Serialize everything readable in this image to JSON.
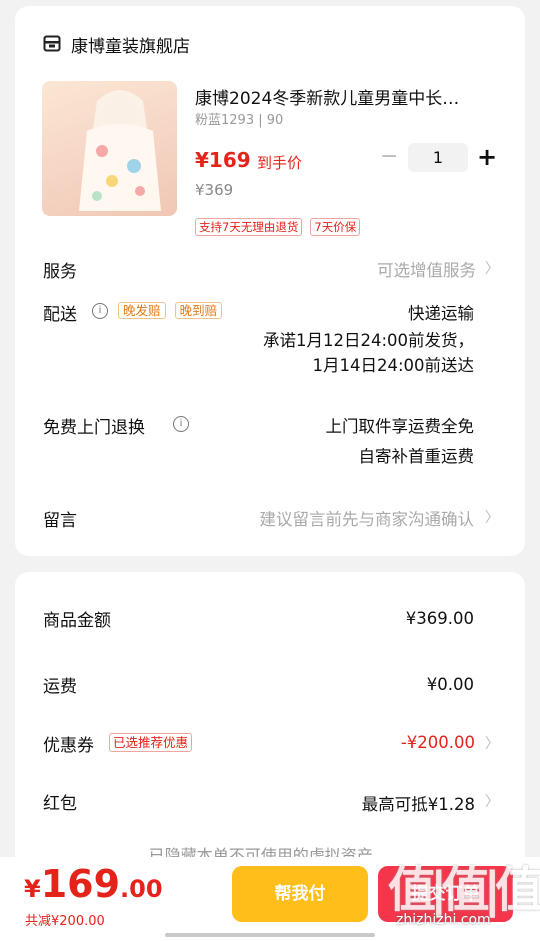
{
  "store": {
    "name": "康博童装旗舰店",
    "icon": "store-icon"
  },
  "product": {
    "title": "康博2024冬季新款儿童男童中长…",
    "variant": "粉蓝1293 | 90",
    "price": "¥169",
    "price_tag": "到手价",
    "original_price": "¥369",
    "badges": [
      "支持7天无理由退货",
      "7天价保"
    ],
    "quantity": "1"
  },
  "rows": {
    "service": {
      "label": "服务",
      "hint": "可选增值服务"
    },
    "delivery": {
      "label": "配送",
      "tags": [
        "晚发赔",
        "晚到赔"
      ],
      "method": "快递运输",
      "promise_line1": "承诺1月12日24:00前发货，",
      "promise_line2": "1月14日24:00前送达"
    },
    "return": {
      "label": "免费上门退换",
      "line1": "上门取件享运费全免",
      "line2": "自寄补首重运费"
    },
    "message": {
      "label": "留言",
      "hint": "建议留言前先与商家沟通确认"
    }
  },
  "summary": {
    "goods": {
      "label": "商品金额",
      "value": "¥369.00"
    },
    "shipping": {
      "label": "运费",
      "value": "¥0.00"
    },
    "coupon": {
      "label": "优惠券",
      "tag": "已选推荐优惠",
      "value": "-¥200.00"
    },
    "redpacket": {
      "label": "红包",
      "value": "最高可抵¥1.28"
    },
    "hidden_note": "已隐藏本单不可使用的虚拟资产"
  },
  "footer": {
    "total_symbol": "¥",
    "total_int": "169",
    "total_dec": ".00",
    "saved": "共减¥200.00",
    "pay_for_me": "帮我付",
    "submit": "提交订单"
  },
  "watermark": {
    "big": "值|值|值",
    "small": "zhizhizhi.com"
  },
  "colors": {
    "accent_red": "#e4231b",
    "pay_yellow": "#ffbe1a",
    "submit_red": "#f5354a"
  }
}
